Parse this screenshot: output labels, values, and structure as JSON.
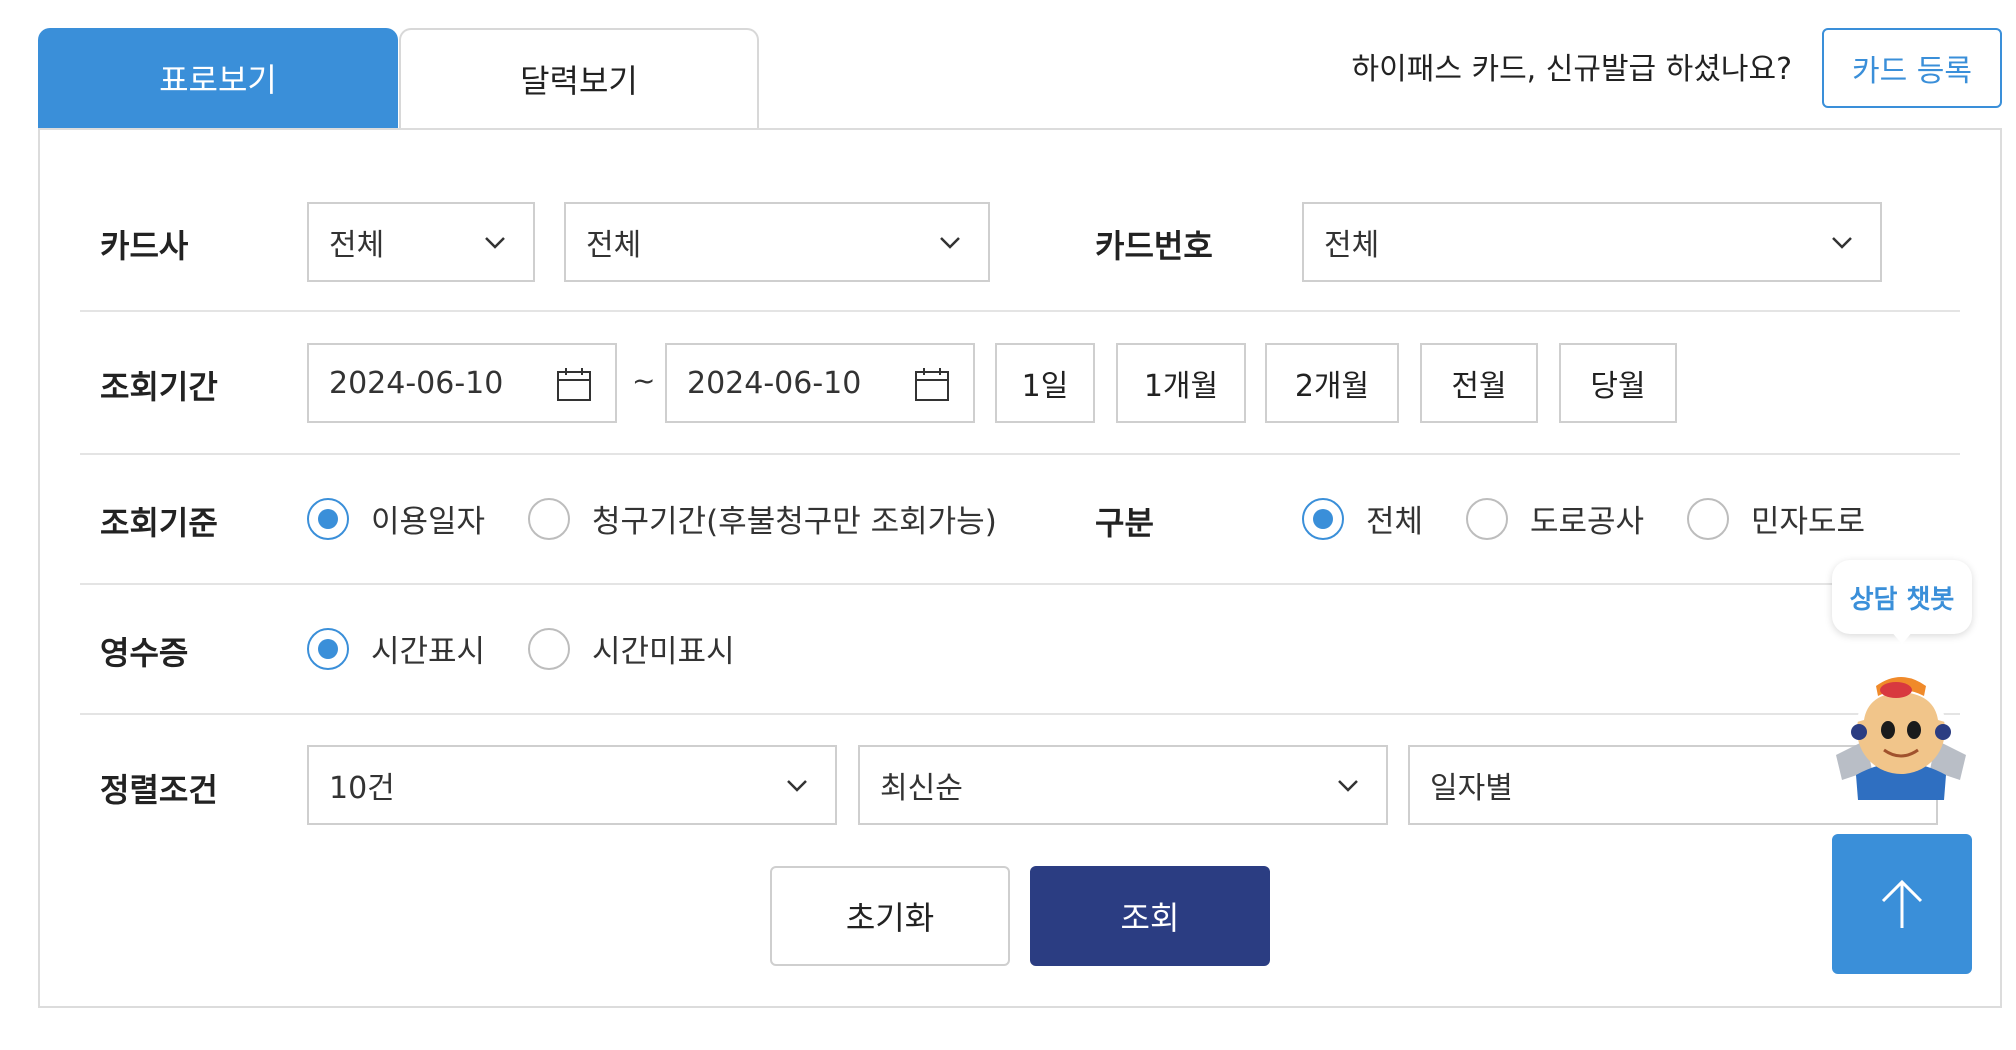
{
  "tabs": [
    {
      "label": "표로보기",
      "active": true
    },
    {
      "label": "달력보기",
      "active": false
    }
  ],
  "promo": {
    "text": "하이패스 카드, 신규발급 하셨나요?",
    "button_label": "카드 등록"
  },
  "filters": {
    "card_company": {
      "label": "카드사",
      "select1": "전체",
      "select2": "전체"
    },
    "card_number": {
      "label": "카드번호",
      "select": "전체"
    },
    "period": {
      "label": "조회기간",
      "start": "2024-06-10",
      "separator": "~",
      "end": "2024-06-10",
      "presets": [
        "1일",
        "1개월",
        "2개월",
        "전월",
        "당월"
      ]
    },
    "criteria": {
      "label": "조회기준",
      "options": [
        {
          "label": "이용일자",
          "selected": true
        },
        {
          "label": "청구기간(후불청구만 조회가능)",
          "selected": false
        }
      ]
    },
    "category": {
      "label": "구분",
      "options": [
        {
          "label": "전체",
          "selected": true
        },
        {
          "label": "도로공사",
          "selected": false
        },
        {
          "label": "민자도로",
          "selected": false
        }
      ]
    },
    "receipt": {
      "label": "영수증",
      "options": [
        {
          "label": "시간표시",
          "selected": true
        },
        {
          "label": "시간미표시",
          "selected": false
        }
      ]
    },
    "sort": {
      "label": "정렬조건",
      "count": "10건",
      "order": "최신순",
      "group": "일자별"
    }
  },
  "actions": {
    "reset_label": "초기화",
    "search_label": "조회"
  },
  "chatbot": {
    "label": "상담 챗봇"
  },
  "colors": {
    "accent": "#3a8fd9",
    "primary_button": "#2b3d82"
  },
  "icons": [
    "chevron-down-icon",
    "calendar-icon",
    "arrow-up-icon",
    "chatbot-mascot-icon"
  ]
}
